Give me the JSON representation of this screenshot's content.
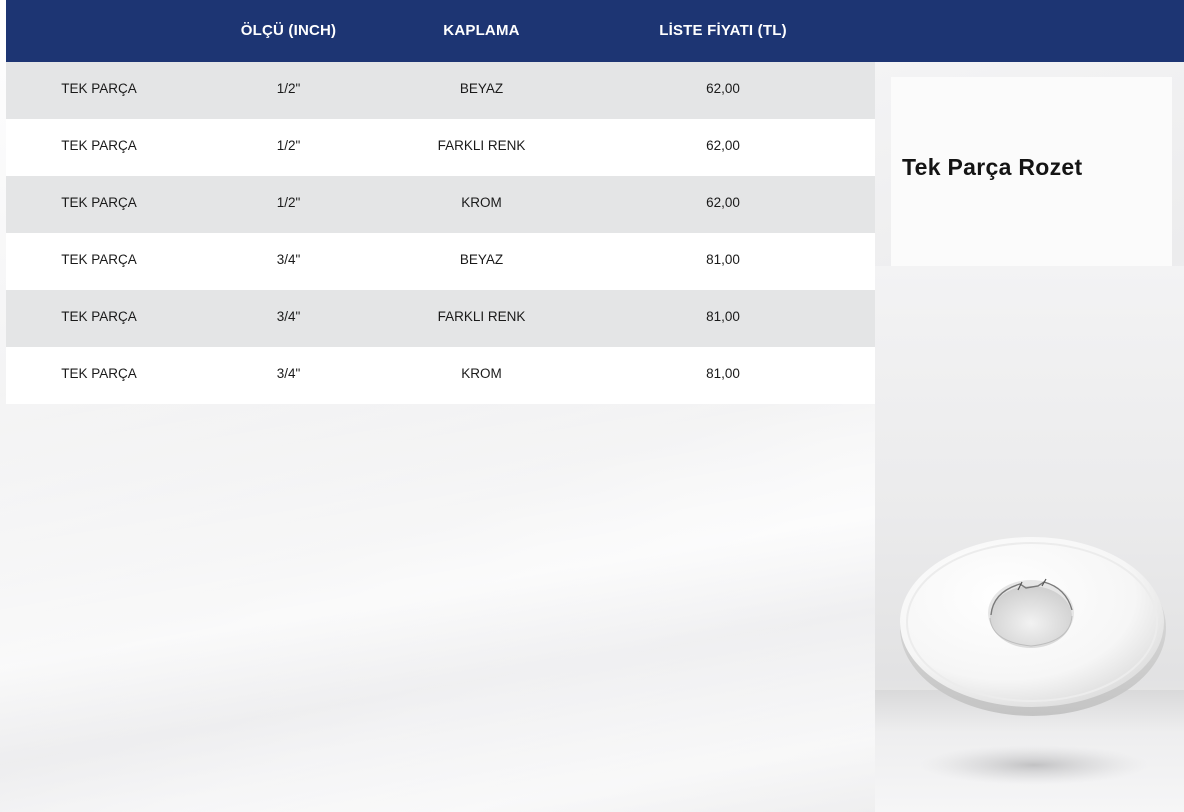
{
  "table": {
    "headers": [
      "",
      "ÖLÇÜ (INCH)",
      "KAPLAMA",
      "LİSTE FİYATI (TL)"
    ],
    "rows": [
      [
        "TEK PARÇA",
        "1/2\"",
        "BEYAZ",
        "62,00"
      ],
      [
        "TEK PARÇA",
        "1/2\"",
        "FARKLI RENK",
        "62,00"
      ],
      [
        "TEK PARÇA",
        "1/2\"",
        "KROM",
        "62,00"
      ],
      [
        "TEK PARÇA",
        "3/4\"",
        "BEYAZ",
        "81,00"
      ],
      [
        "TEK PARÇA",
        "3/4\"",
        "FARKLI RENK",
        "81,00"
      ],
      [
        "TEK PARÇA",
        "3/4\"",
        "KROM",
        "81,00"
      ]
    ]
  },
  "product": {
    "title": "Tek Parça Rozet",
    "image": "white-rosette-flange"
  },
  "colors": {
    "header_bg": "#1d3573",
    "row_alt_bg": "#e4e5e6",
    "row_bg": "#ffffff"
  }
}
